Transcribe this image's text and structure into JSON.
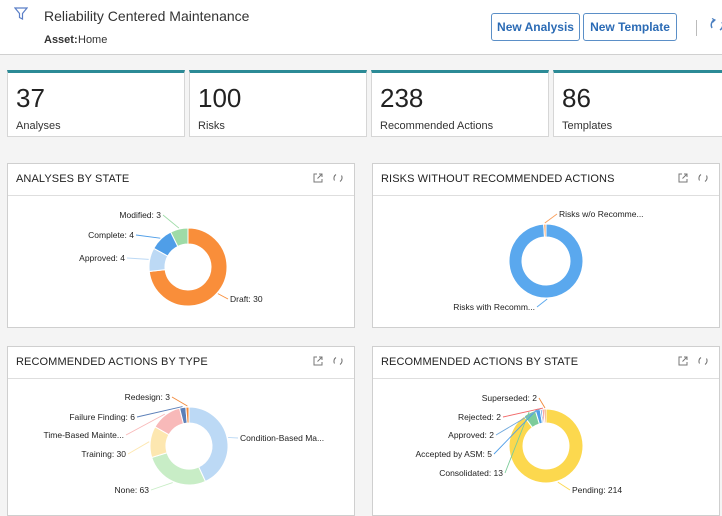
{
  "header": {
    "title": "Reliability Centered Maintenance",
    "asset_label": "Asset:",
    "asset_value": "Home",
    "new_analysis_label": "New Analysis",
    "new_template_label": "New Template"
  },
  "tiles": [
    {
      "value": "37",
      "label": "Analyses"
    },
    {
      "value": "100",
      "label": "Risks"
    },
    {
      "value": "238",
      "label": "Recommended Actions"
    },
    {
      "value": "86",
      "label": "Templates"
    }
  ],
  "colors": {
    "accent": "#2b8a96",
    "button_text": "#2b6bb5",
    "button_border": "#5b8fc7"
  },
  "icons": [
    "filter-icon",
    "refresh-icon",
    "external-link-icon"
  ],
  "panels": {
    "analyses_by_state": {
      "title": "ANALYSES BY STATE"
    },
    "risks_without_actions": {
      "title": "RISKS WITHOUT RECOMMENDED ACTIONS"
    },
    "actions_by_type": {
      "title": "RECOMMENDED ACTIONS BY TYPE"
    },
    "actions_by_state": {
      "title": "RECOMMENDED ACTIONS BY STATE"
    }
  },
  "chart_data": [
    {
      "type": "pie",
      "title": "ANALYSES BY STATE",
      "categories": [
        "Draft",
        "Approved",
        "Complete",
        "Modified"
      ],
      "values": [
        30,
        4,
        4,
        3
      ],
      "labels": [
        "Draft: 30",
        "Approved: 4",
        "Complete: 4",
        "Modified: 3"
      ],
      "colors": [
        "#f98e3a",
        "#bcd9f5",
        "#4f9ee8",
        "#9edba7"
      ]
    },
    {
      "type": "pie",
      "title": "RISKS WITHOUT RECOMMENDED ACTIONS",
      "categories": [
        "Risks with Recomm...",
        "Risks w/o Recomme..."
      ],
      "values": [
        99,
        1
      ],
      "labels": [
        "Risks with Recomm...",
        "Risks w/o Recomme..."
      ],
      "colors": [
        "#5aa8ee",
        "#f9a05e"
      ]
    },
    {
      "type": "pie",
      "title": "RECOMMENDED ACTIONS BY TYPE",
      "categories": [
        "Condition-Based Ma...",
        "None",
        "Training",
        "Time-Based Mainte...",
        "Failure Finding",
        "Redesign"
      ],
      "values": [
        100,
        63,
        30,
        30,
        6,
        3
      ],
      "labels": [
        "Condition-Based Ma...",
        "None: 63",
        "Training: 30",
        "Time-Based Mainte...",
        "Failure Finding: 6",
        "Redesign: 3"
      ],
      "colors": [
        "#bcd9f5",
        "#c8edc6",
        "#fde7b0",
        "#f8b9b9",
        "#5b7fb8",
        "#f2893a"
      ]
    },
    {
      "type": "pie",
      "title": "RECOMMENDED ACTIONS BY STATE",
      "categories": [
        "Pending",
        "Consolidated",
        "Accepted by ASM",
        "Approved",
        "Rejected",
        "Superseded"
      ],
      "values": [
        214,
        13,
        5,
        2,
        2,
        2
      ],
      "labels": [
        "Pending: 214",
        "Consolidated: 13",
        "Accepted by ASM: 5",
        "Approved: 2",
        "Rejected: 2",
        "Superseded: 2"
      ],
      "colors": [
        "#fcd84e",
        "#7ccc9a",
        "#4f9ee8",
        "#6fa8dc",
        "#f26b6b",
        "#f2893a"
      ]
    }
  ]
}
